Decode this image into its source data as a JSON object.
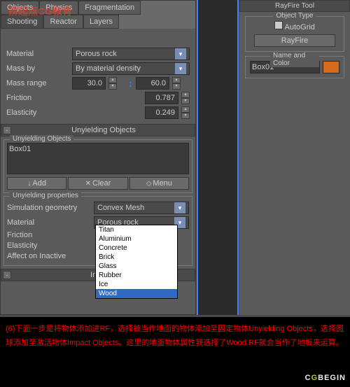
{
  "tabs": {
    "row1": [
      "Objects",
      "Physics",
      "Fragmentation"
    ],
    "row2": [
      "Shooting",
      "Reactor",
      "Layers"
    ]
  },
  "physics": {
    "material_label": "Material",
    "material_value": "Porous rock",
    "massby_label": "Mass by",
    "massby_value": "By material density",
    "massrange_label": "Mass range",
    "massrange_min": "30.0",
    "massrange_max": "60.0",
    "friction_label": "Friction",
    "friction_value": "0.787",
    "elasticity_label": "Elasticity",
    "elasticity_value": "0.249"
  },
  "unyielding": {
    "header": "Unyielding Objects",
    "list_label": "Unyielding Objects",
    "item0": "Box01",
    "btn_add": "Add",
    "btn_clear": "Clear",
    "btn_menu": "Menu"
  },
  "unyprops": {
    "legend": "Unyielding properties",
    "simgeo_label": "Simulation geometry",
    "simgeo_value": "Convex Mesh",
    "material_label": "Material",
    "material_value": "Porous rock",
    "friction_label": "Friction",
    "elasticity_label": "Elasticity",
    "affect_label": "Affect on Inactive",
    "options": [
      "Titan",
      "Aluminium",
      "Concrete",
      "Brick",
      "Glass",
      "Rubber",
      "Ice",
      "Wood"
    ]
  },
  "inactive_header": "Inactive",
  "right": {
    "tool_title": "RayFire Tool",
    "objtype_legend": "Object Type",
    "autogrid": "AutoGrid",
    "rayfire_btn": "RayFire",
    "namecolor_legend": "Name and Color",
    "name_value": "Box01"
  },
  "caption_text": "(6)下面一步是将物体添加进RF，选择被当作地面的物体添加至固定物体Unyielding Objects，选择圆球添加至激活物体Impact Objects。这里的地面物体属性我选择了Wood.RF就会当作了地板来运算。",
  "watermark": "捞起点CG教育",
  "logo_pre": "C",
  "logo_g": "G",
  "logo_post": "BEGIN"
}
